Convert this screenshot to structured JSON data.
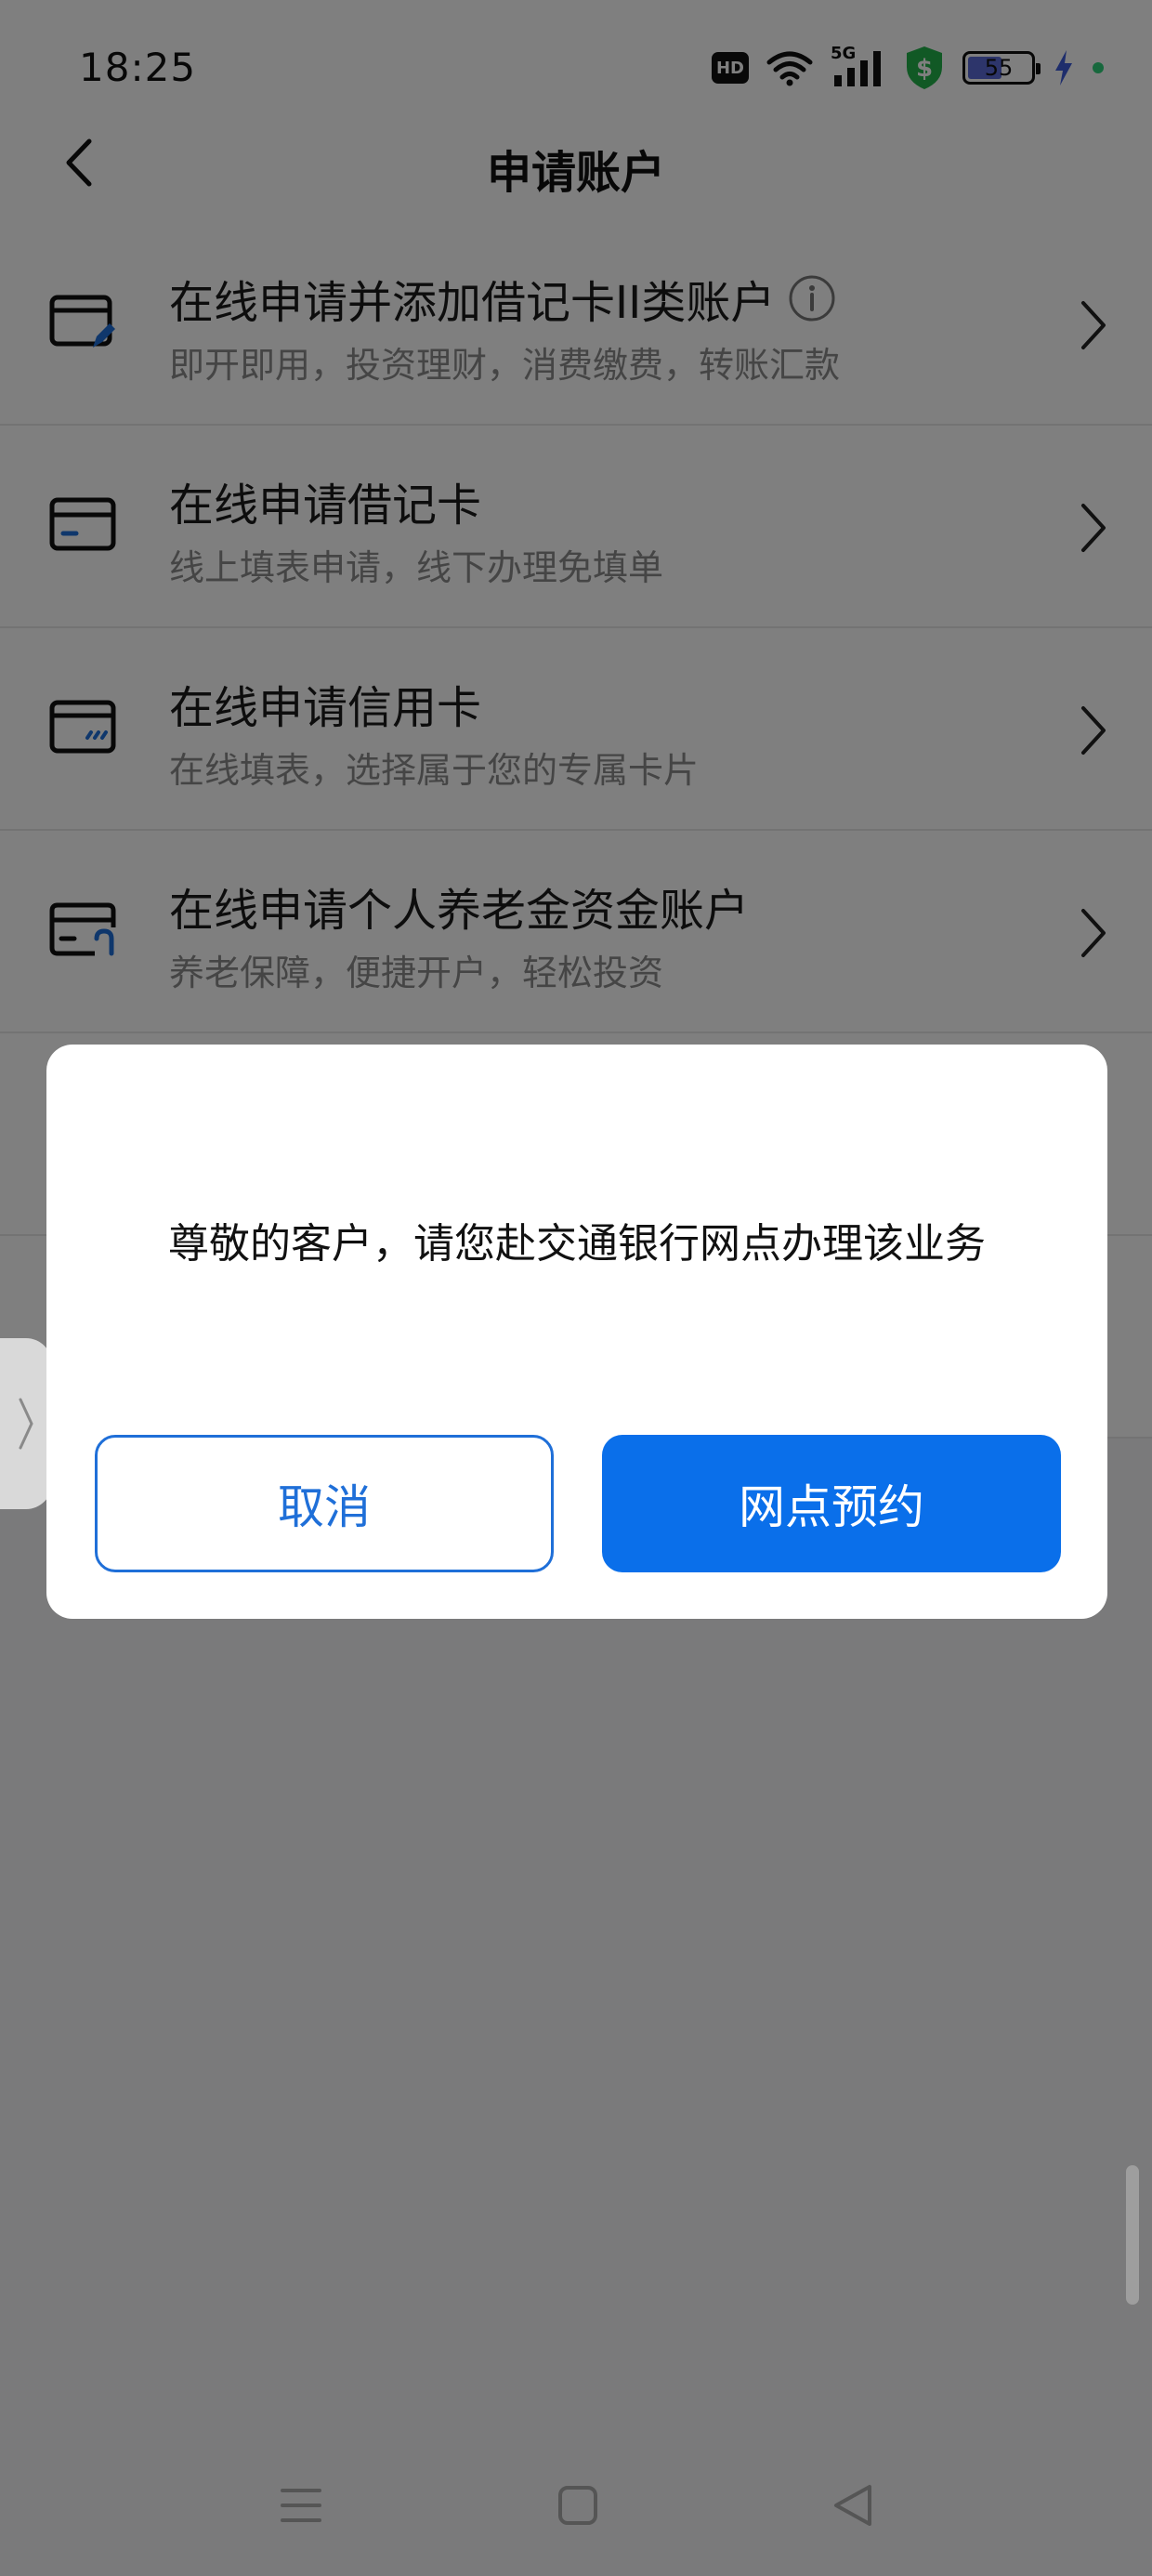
{
  "status_bar": {
    "time": "18:25",
    "hd_label": "HD",
    "network_label": "5G",
    "battery_level": "55",
    "battery_fraction": 0.55,
    "icons": [
      "hd-icon",
      "wifi-icon",
      "signal-5g-icon",
      "shield-dollar-icon",
      "battery-icon",
      "charging-icon"
    ]
  },
  "header": {
    "title": "申请账户",
    "back_icon": "chevron-left-icon"
  },
  "list": {
    "items": [
      {
        "title": "在线申请并添加借记卡II类账户",
        "subtitle": "即开即用，投资理财，消费缴费，转账汇款",
        "icon": "card-edit-icon",
        "has_info": true
      },
      {
        "title": "在线申请借记卡",
        "subtitle": "线上填表申请，线下办理免填单",
        "icon": "debit-card-icon",
        "has_info": false
      },
      {
        "title": "在线申请信用卡",
        "subtitle": "在线填表，选择属于您的专属卡片",
        "icon": "credit-card-icon",
        "has_info": false
      },
      {
        "title": "在线申请个人养老金资金账户",
        "subtitle": "养老保障，便捷开户，轻松投资",
        "icon": "pension-card-icon",
        "has_info": false
      }
    ]
  },
  "dialog": {
    "message": "尊敬的客户，请您赴交通银行网点办理该业务",
    "cancel_label": "取消",
    "confirm_label": "网点预约"
  },
  "colors": {
    "accent": "#0a6fea",
    "accent_outline": "#1f6fd8",
    "overlay": "rgba(0,0,0,0.5)",
    "icon_blue": "#1f6fd8"
  },
  "nav_bar": {
    "icons": [
      "menu-icon",
      "home-square-icon",
      "back-triangle-icon"
    ]
  }
}
